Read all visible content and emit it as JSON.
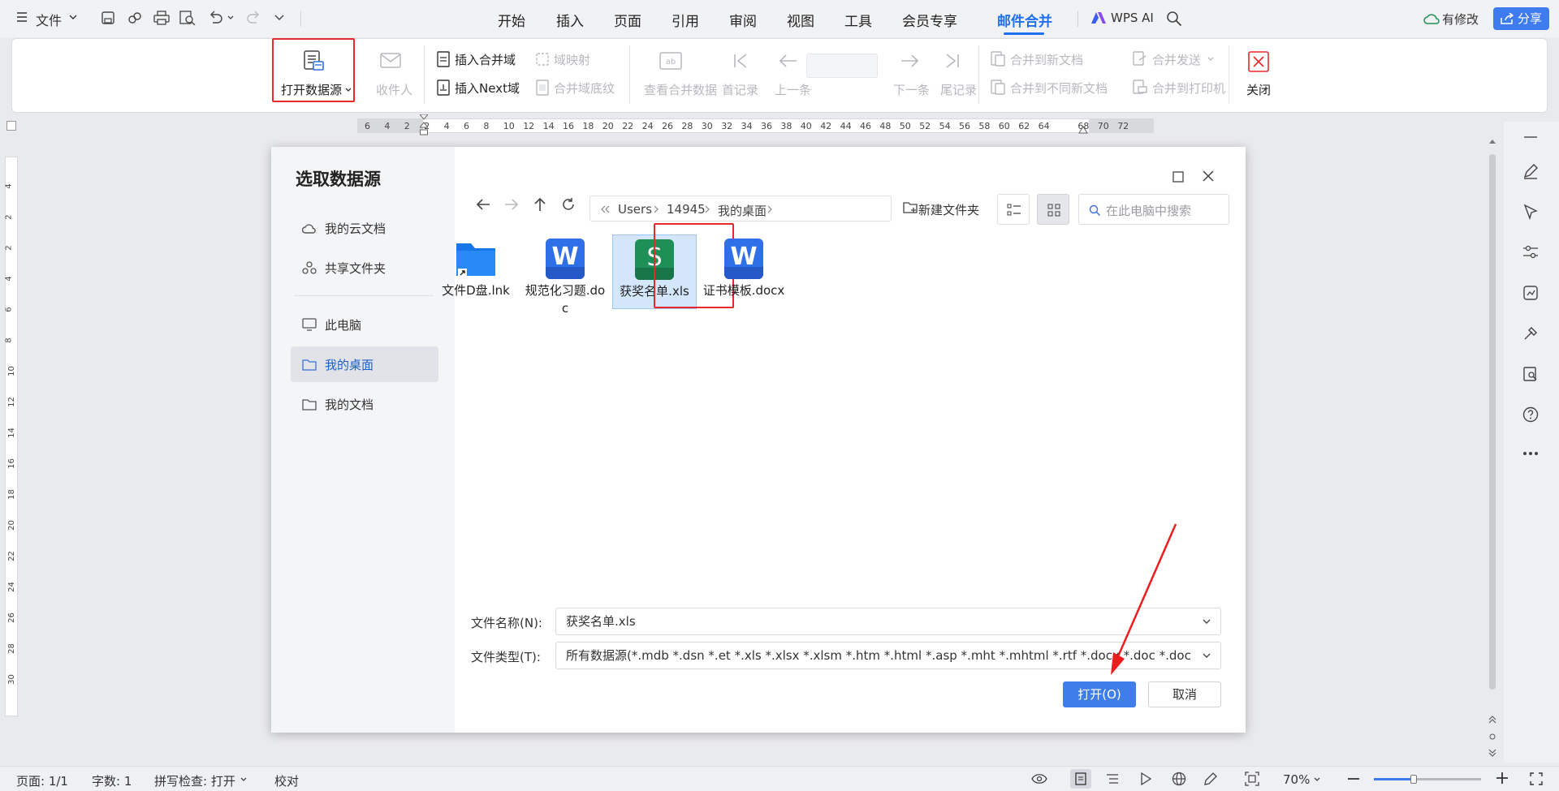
{
  "topbar": {
    "file_menu": "文件",
    "tabs": [
      "开始",
      "插入",
      "页面",
      "引用",
      "审阅",
      "视图",
      "工具",
      "会员专享",
      "邮件合并"
    ],
    "active_tab": "邮件合并",
    "wps_ai": "WPS AI",
    "has_changes": "有修改",
    "share": "分享"
  },
  "ribbon": {
    "open_datasource": "打开数据源",
    "recipients": "收件人",
    "insert_merge_field": "插入合并域",
    "insert_next_field": "插入Next域",
    "field_mapping": "域映射",
    "merge_field_shading": "合并域底纹",
    "view_merged_data": "查看合并数据",
    "first_record": "首记录",
    "prev_record": "上一条",
    "next_record": "下一条",
    "last_record": "尾记录",
    "merge_to_new_doc": "合并到新文档",
    "merge_to_diff_docs": "合并到不同新文档",
    "merge_send": "合并发送",
    "merge_to_printer": "合并到打印机",
    "close": "关闭"
  },
  "ruler": {
    "marks": [
      "6",
      "4",
      "2",
      "2",
      "4",
      "6",
      "8",
      "10",
      "12",
      "14",
      "16",
      "18",
      "20",
      "22",
      "24",
      "26",
      "28",
      "30",
      "32",
      "34",
      "36",
      "38",
      "40",
      "42",
      "44",
      "46",
      "48",
      "50",
      "52",
      "54",
      "56",
      "58",
      "60",
      "62",
      "64",
      "68",
      "70",
      "72"
    ]
  },
  "vruler": {
    "marks": [
      "4",
      "2",
      "2",
      "4",
      "6",
      "8",
      "10",
      "12",
      "14",
      "16",
      "18",
      "20",
      "22",
      "24",
      "26",
      "28",
      "30"
    ]
  },
  "dialog": {
    "title": "选取数据源",
    "side": {
      "cloud_docs": "我的云文档",
      "shared_folder": "共享文件夹",
      "this_pc": "此电脑",
      "desktop": "我的桌面",
      "documents": "我的文档"
    },
    "path": [
      "Users",
      "14945",
      "我的桌面"
    ],
    "new_folder": "新建文件夹",
    "search_placeholder": "在此电脑中搜索",
    "files": [
      {
        "name": "文件D盘.lnk",
        "type": "folder"
      },
      {
        "name": "规范化习题.doc",
        "type": "word"
      },
      {
        "name": "获奖名单.xls",
        "type": "sheet"
      },
      {
        "name": "证书模板.docx",
        "type": "word"
      }
    ],
    "file_name_label": "文件名称(N):",
    "file_name_value": "获奖名单.xls",
    "file_type_label": "文件类型(T):",
    "file_type_value": "所有数据源(*.mdb *.dsn *.et *.xls *.xlsx *.xlsm *.htm *.html *.asp *.mht *.mhtml *.rtf *.docx *.doc *.docm *.dc",
    "open_button": "打开(O)",
    "cancel_button": "取消"
  },
  "statusbar": {
    "page": "页面: 1/1",
    "word_count": "字数: 1",
    "spell_check": "拼写检查: 打开",
    "proofread": "校对",
    "zoom": "70%"
  },
  "colors": {
    "accent": "#1f6ff0",
    "highlight_box": "#e8292b",
    "sheet_icon": "#1d8f57",
    "word_icon": "#2f6fe8"
  }
}
